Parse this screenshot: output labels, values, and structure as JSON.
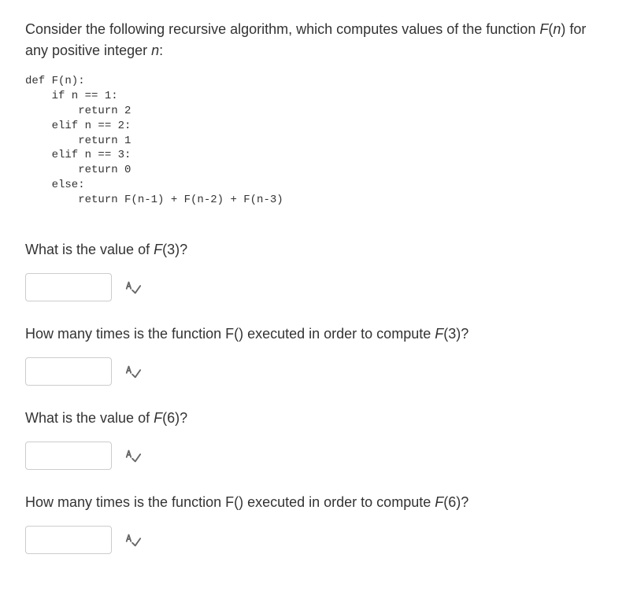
{
  "intro": {
    "part1": "Consider the following recursive algorithm, which computes values of the function ",
    "funcF": "F",
    "funcOpen": "(",
    "funcN": "n",
    "funcClose": ")",
    "part2": " for any positive integer ",
    "n": "n",
    "colon": ":"
  },
  "code": "def F(n):\n    if n == 1:\n        return 2\n    elif n == 2:\n        return 1\n    elif n == 3:\n        return 0\n    else:\n        return F(n-1) + F(n-2) + F(n-3)",
  "questions": {
    "q1": {
      "part1": "What is the value of ",
      "F": "F",
      "num": "(3)",
      "qmark": "?"
    },
    "q2": {
      "text": "How many times is the function F() executed in order to compute ",
      "F": "F",
      "num": "(3)",
      "qmark": "?"
    },
    "q3": {
      "part1": "What is the value of ",
      "F": "F",
      "num": "(6)",
      "qmark": "?"
    },
    "q4": {
      "text": "How many times is the function F() executed in order to compute ",
      "F": "F",
      "num": "(6)",
      "qmark": "?"
    }
  }
}
